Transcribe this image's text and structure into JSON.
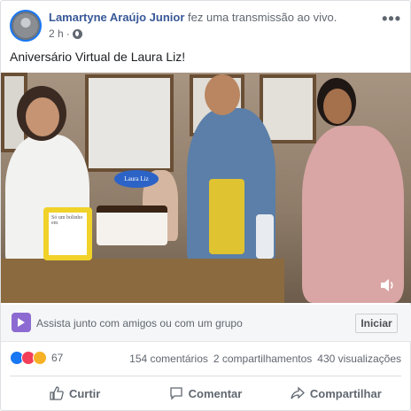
{
  "post": {
    "author": "Lamartyne Araújo Junior",
    "action": "fez uma transmissão ao vivo.",
    "time": "2 h",
    "more": "•••",
    "text": "Aniversário Virtual de Laura Liz!"
  },
  "video": {
    "cake_topper": "Laura Liz",
    "frame_sign": "Só um bolinho em"
  },
  "watch_party": {
    "text": "Assista junto com amigos ou com um grupo",
    "button": "Iniciar"
  },
  "stats": {
    "reactions_count": "67",
    "comments": "154 comentários",
    "shares": "2 compartilhamentos",
    "views": "430 visualizações"
  },
  "actions": {
    "like": "Curtir",
    "comment": "Comentar",
    "share": "Compartilhar"
  },
  "icons": {
    "globe": "globe-icon",
    "like": "like-icon",
    "comment": "comment-icon",
    "share": "share-icon",
    "watch": "watch-party-icon",
    "sound": "sound-icon"
  },
  "colors": {
    "author": "#385898",
    "accent": "#1877f2",
    "watch": "#8c6ad1",
    "love": "#f33e58",
    "care": "#f7b125"
  }
}
